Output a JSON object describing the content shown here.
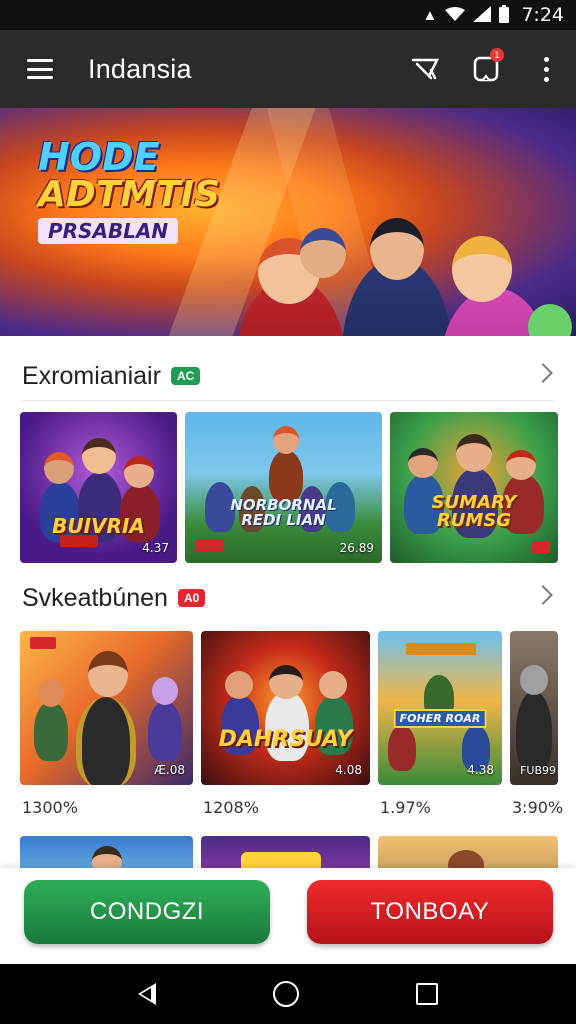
{
  "status_bar": {
    "time": "7:24",
    "icons": [
      "nfc-icon",
      "wifi-icon",
      "signal-icon",
      "battery-icon"
    ]
  },
  "app_bar": {
    "title": "Indansia",
    "icons": [
      "menu-icon",
      "cast-icon",
      "notification-icon",
      "more-vert-icon"
    ],
    "notification_count": "1"
  },
  "hero": {
    "title_line1": "HODE",
    "title_line2": "ADTMTIS",
    "title_line3": "PRSABLAN"
  },
  "sections": [
    {
      "title": "Exromianiair",
      "tag": "AC",
      "tag_color": "#1f9d55",
      "cards": [
        {
          "art": "BUIVRIA",
          "size": "4.37"
        },
        {
          "art": "NORBORNAL\nREDI LIAN",
          "size": "26.89"
        },
        {
          "art": "SUMARY\nRUMSG",
          "size": ""
        }
      ]
    },
    {
      "title": "Svkeatbúnen",
      "tag": "A0",
      "tag_color": "#e0282e",
      "cards": [
        {
          "art": "",
          "size": "Æ.08",
          "rating": "1300%"
        },
        {
          "art": "DAHRSUAY",
          "size": "4.08",
          "rating": "1208%"
        },
        {
          "art": "FOHER ROAR",
          "size": "4.38",
          "rating": "1.97%"
        },
        {
          "art": "",
          "size": "FUB99",
          "rating": "3:90%"
        }
      ]
    }
  ],
  "actions": {
    "primary_label": "CONDGZI",
    "secondary_label": "TONBOAY",
    "primary_color": "#1f9449",
    "secondary_color": "#e0202a"
  },
  "nav": {
    "icons": [
      "back-icon",
      "home-icon",
      "recents-icon"
    ]
  }
}
